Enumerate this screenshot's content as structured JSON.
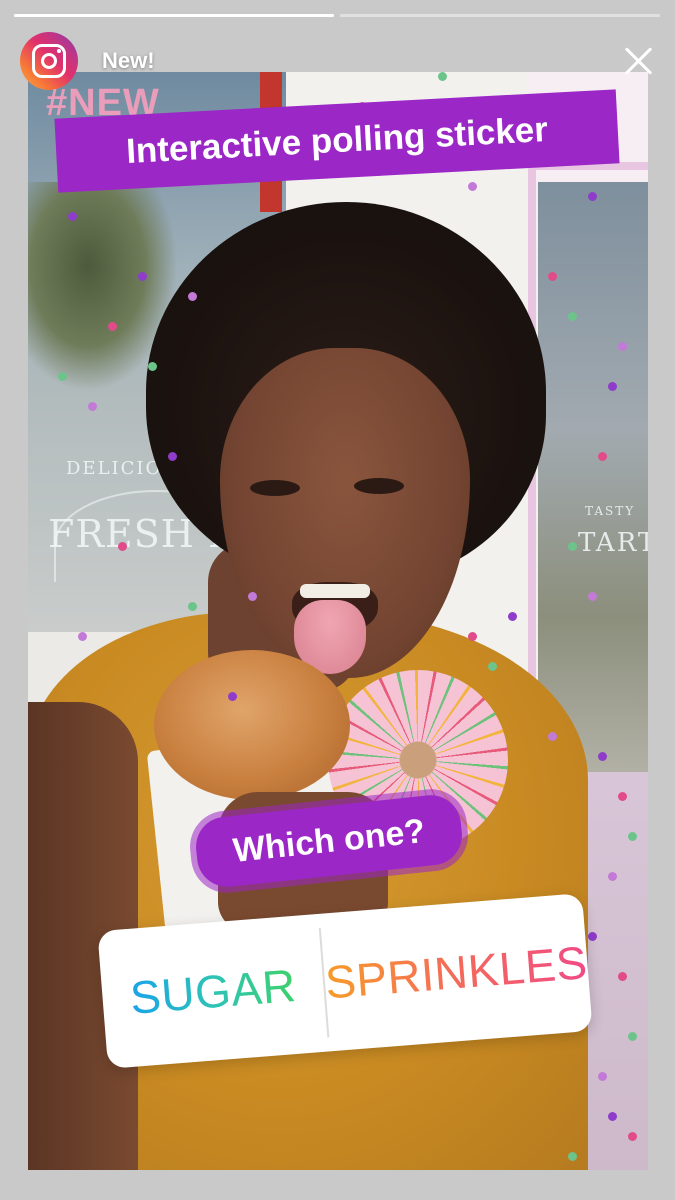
{
  "story": {
    "username": "New!",
    "progress_segments": [
      {
        "fill": 1.0
      },
      {
        "fill": 0.0
      },
      {
        "fill": 0.0
      }
    ],
    "close_icon": "close-icon",
    "avatar_icon": "instagram-logo-icon"
  },
  "photo": {
    "hashtag_text": "#NEW",
    "shop_sign_left_top": "DELICIO",
    "shop_sign_left_main": "FRESH PIES",
    "shop_sign_right_top": "TASTY",
    "shop_sign_right_main": "TARTS"
  },
  "caption": {
    "title": "Interactive polling sticker",
    "title_bg_color": "#9b27c7"
  },
  "poll": {
    "question": "Which one?",
    "question_bg_color": "#9b27c7",
    "options": [
      {
        "label": "SUGAR",
        "gradient": [
          "#1aa3e8",
          "#3ed16a"
        ]
      },
      {
        "label": "SPRINKLES",
        "gradient": [
          "#f79c2a",
          "#ef4b86"
        ]
      }
    ]
  },
  "confetti_colors": [
    "#8e3cc9",
    "#e14b8a",
    "#6cc48a",
    "#c27ad6"
  ]
}
